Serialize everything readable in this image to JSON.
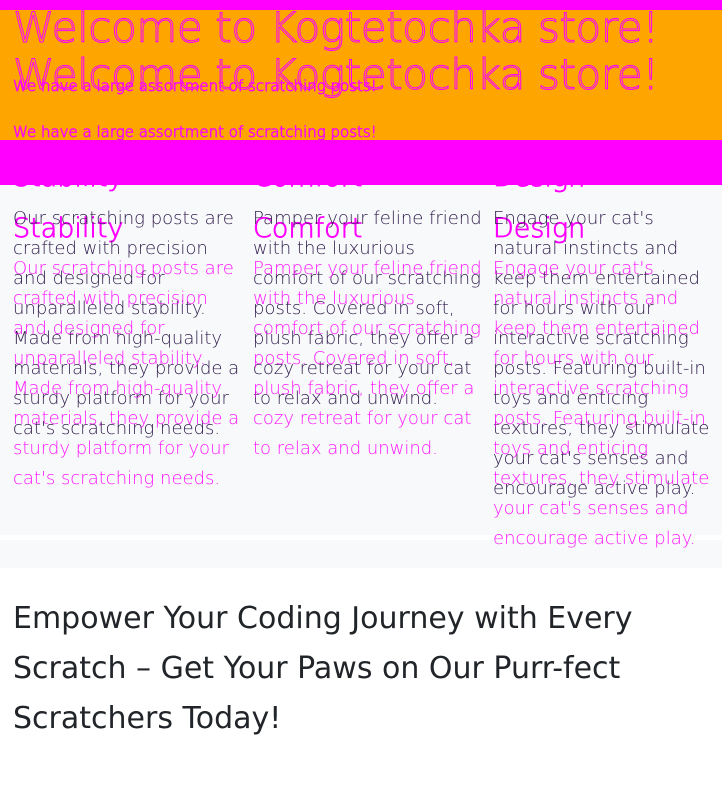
{
  "hero": {
    "title": "Welcome to Kogtetochka store!",
    "subtitle": "We have a large assortment of scratching posts!"
  },
  "features": [
    {
      "title": "Stability",
      "text": "Our scratching posts are crafted with precision and designed for unparalleled stability. Made from high-quality materials, they provide a sturdy platform for your cat's scratching needs."
    },
    {
      "title": "Comfort",
      "text": "Pamper your feline friend with the luxurious comfort of our scratching posts. Covered in soft, plush fabric, they offer a cozy retreat for your cat to relax and unwind."
    },
    {
      "title": "Design",
      "text": "Engage your cat's natural instincts and keep them entertained for hours with our interactive scratching posts. Featuring built-in toys and enticing textures, they stimulate your cat's senses and encourage active play."
    }
  ],
  "cta": {
    "text": "Empower Your Coding Journey with Every Scratch – Get Your Paws on Our Purr-fect Scratchers Today!"
  },
  "colors": {
    "hero_bg": "#ffa500",
    "accent_magenta": "#ff00ff",
    "features_bg": "#f8f9fa",
    "text_dark": "#212529"
  }
}
